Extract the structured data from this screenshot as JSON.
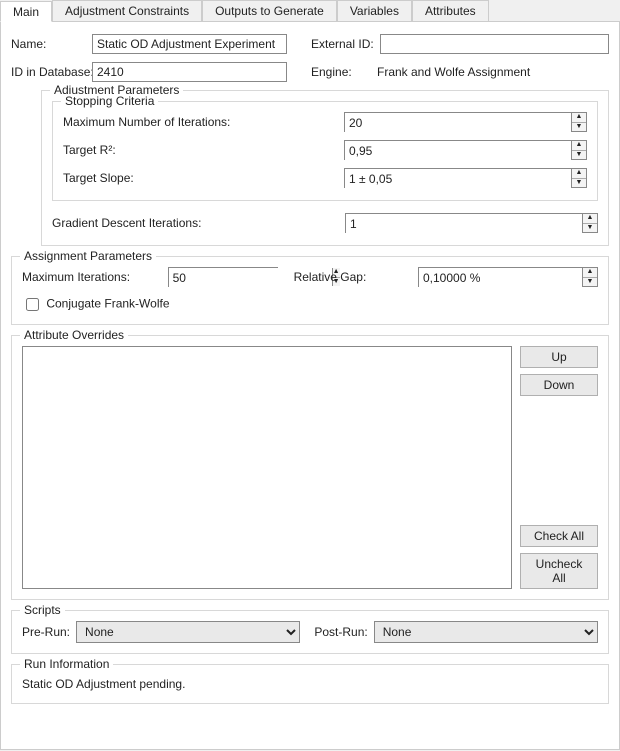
{
  "tabs": [
    "Main",
    "Adjustment Constraints",
    "Outputs to Generate",
    "Variables",
    "Attributes"
  ],
  "activeTab": 0,
  "fields": {
    "name_label": "Name:",
    "name_value": "Static OD Adjustment Experiment",
    "external_id_label": "External ID:",
    "external_id_value": "",
    "id_db_label": "ID in Database:",
    "id_db_value": "2410",
    "engine_label": "Engine:",
    "engine_value": "Frank and Wolfe Assignment"
  },
  "adjustment": {
    "legend": "Adjustment Parameters",
    "stopping_legend": "Stopping Criteria",
    "max_iter_label": "Maximum Number of Iterations:",
    "max_iter_value": "20",
    "target_r2_label": "Target R²:",
    "target_r2_value": "0,95",
    "target_slope_label": "Target Slope:",
    "target_slope_value": "1 ± 0,05",
    "gd_iter_label": "Gradient Descent Iterations:",
    "gd_iter_value": "1"
  },
  "assignment": {
    "legend": "Assignment Parameters",
    "max_iter_label": "Maximum Iterations:",
    "max_iter_value": "50",
    "rel_gap_label": "Relative Gap:",
    "rel_gap_value": "0,10000 %",
    "conjugate_label": "Conjugate Frank-Wolfe",
    "conjugate_checked": false
  },
  "overrides": {
    "legend": "Attribute Overrides",
    "btn_up": "Up",
    "btn_down": "Down",
    "btn_check_all": "Check All",
    "btn_uncheck_all": "Uncheck All"
  },
  "scripts": {
    "legend": "Scripts",
    "pre_label": "Pre-Run:",
    "pre_value": "None",
    "post_label": "Post-Run:",
    "post_value": "None"
  },
  "runinfo": {
    "legend": "Run Information",
    "text": "Static OD Adjustment pending."
  }
}
